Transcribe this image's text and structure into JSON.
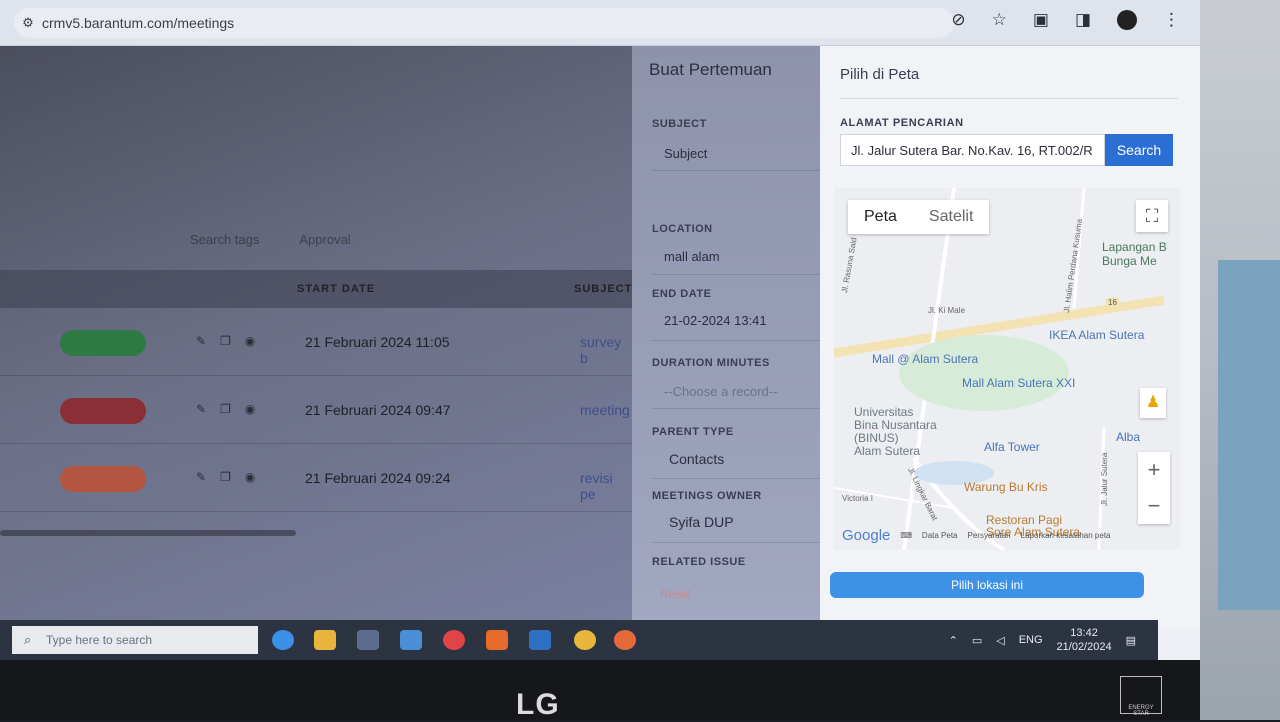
{
  "browser": {
    "url": "crmv5.barantum.com/meetings"
  },
  "list": {
    "filter_tags": "Search tags",
    "filter_approval": "Approval",
    "columns": [
      "START DATE",
      "SUBJECT"
    ],
    "rows": [
      {
        "date": "21 Februari 2024 11:05",
        "subject": "survey b",
        "status_color": "#2f7a43"
      },
      {
        "date": "21 Februari 2024 09:47",
        "subject": "meeting",
        "status_color": "#8a2f35"
      },
      {
        "date": "21 Februari 2024 09:24",
        "subject": "revisi pe",
        "status_color": "#b4553f"
      }
    ]
  },
  "form": {
    "title": "Buat Pertemuan",
    "subject_label": "SUBJECT",
    "subject_placeholder": "Subject",
    "location_label": "LOCATION",
    "location_value": "mall alam",
    "end_date_label": "END DATE",
    "end_date_value": "21-02-2024 13:41",
    "duration_label": "DURATION MINUTES",
    "duration_placeholder": "--Choose a record--",
    "parent_type_label": "PARENT TYPE",
    "parent_type_value": "Contacts",
    "owner_label": "MEETINGS OWNER",
    "owner_value": "Syifa DUP",
    "related_issue_label": "RELATED ISSUE",
    "reset_label": "Reset"
  },
  "map_panel": {
    "title": "Pilih di Peta",
    "address_label": "ALAMAT PENCARIAN",
    "address_value": "Jl. Jalur Sutera Bar. No.Kav. 16, RT.002/R",
    "search_label": "Search",
    "tab_map": "Peta",
    "tab_satellite": "Satelit",
    "pick_button": "Pilih lokasi ini",
    "attribution": [
      "Data Peta",
      "Persyaratan",
      "Laporkan kesalahan peta"
    ],
    "google": "Google",
    "places": [
      {
        "name": "Lapangan B",
        "line2": "Bunga Me"
      },
      {
        "name": "IKEA Alam Sutera"
      },
      {
        "name": "Mall @ Alam Sutera"
      },
      {
        "name": "Mall Alam Sutera XXI"
      },
      {
        "name": "Universitas",
        "line2": "Bina Nusantara",
        "line3": "(BINUS)",
        "line4": "Alam Sutera"
      },
      {
        "name": "Alfa Tower"
      },
      {
        "name": "Warung Bu Kris"
      },
      {
        "name": "Restoran Pagi",
        "line2": "Sore Alam Sutera"
      },
      {
        "name": "Alba"
      }
    ],
    "streets": [
      "Jl. Ki Male",
      "Jl. Rasuna Said",
      "Jl. Halim Perdana Kusuma",
      "Jl. Lingkar Barat",
      "Jl. Jalur Sutera",
      "Victoria I",
      "16"
    ]
  },
  "taskbar": {
    "search_placeholder": "Type here to search",
    "lang": "ENG",
    "time": "13:42",
    "date": "21/02/2024"
  },
  "monitor": {
    "brand": "LG",
    "energy": "ENERGY STAR"
  }
}
